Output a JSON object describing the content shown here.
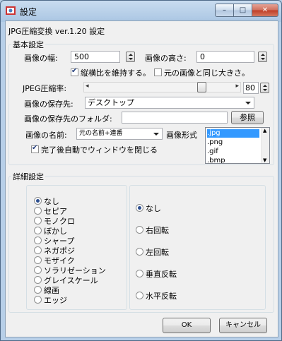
{
  "window": {
    "title": "設定",
    "min": "–",
    "max": "□",
    "close": "✕"
  },
  "header": "JPG圧縮変換 ver.1.20 設定",
  "basic": {
    "legend": "基本設定",
    "width_label": "画像の幅:",
    "width_value": "500",
    "height_label": "画像の高さ:",
    "height_value": "0",
    "keep_ratio": "縦横比を維持する。",
    "keep_ratio_checked": true,
    "same_size": "元の画像と同じ大きさ。",
    "same_size_checked": false,
    "jpeg_label": "JPEG圧縮率:",
    "jpeg_value": "80",
    "jpeg_quality_fraction": 0.8,
    "save_to_label": "画像の保存先:",
    "save_to_value": "デスクトップ",
    "folder_label": "画像の保存先のフォルダ:",
    "folder_value": "",
    "browse": "参照",
    "name_label": "画像の名前:",
    "name_value": "元の名前+連番",
    "format_label": "画像形式",
    "formats": [
      ".jpg",
      ".png",
      ".gif",
      ".bmp"
    ],
    "auto_close": "完了後自動でウィンドウを閉じる",
    "auto_close_checked": true
  },
  "detail": {
    "legend": "詳細設定",
    "effects": [
      "なし",
      "セピア",
      "モノクロ",
      "ぼかし",
      "シャープ",
      "ネガポジ",
      "モザイク",
      "ソラリゼーション",
      "グレイスケール",
      "線画",
      "エッジ"
    ],
    "effect_selected": 0,
    "rotations": [
      "なし",
      "右回転",
      "左回転",
      "垂直反転",
      "水平反転"
    ],
    "rotation_selected": 0
  },
  "buttons": {
    "ok": "OK",
    "cancel": "キャンセル"
  },
  "colors": {
    "selection": "#3399ff",
    "frame": "#b7cfe8"
  }
}
